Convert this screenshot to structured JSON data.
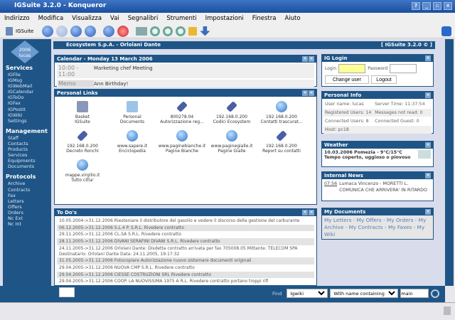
{
  "window": {
    "title": "IGSuite 3.2.0 - Konqueror",
    "controls": [
      "?",
      "_",
      "▫",
      "×"
    ]
  },
  "menu": [
    "Indirizzo",
    "Modifica",
    "Visualizza",
    "Vai",
    "Segnalibri",
    "Strumenti",
    "Impostazioni",
    "Finestra",
    "Aiuto"
  ],
  "toolbar": {
    "app_label": "IGSuite"
  },
  "header": {
    "company": "Ecosystem S.p.A. - Orlolani Dante",
    "version": "[ IGSuite 3.2.0 © ]"
  },
  "nav": {
    "year": "2006",
    "user": "lucas"
  },
  "sidebar": [
    {
      "title": "Services",
      "items": [
        "IGFile",
        "IGMsg",
        "IGWebMail",
        "IGCalendar",
        "IGToDo",
        "IGFax",
        "IGPostIt",
        "IGWiki",
        "Settings"
      ]
    },
    {
      "title": "Management",
      "items": [
        "Staff",
        "Contacts",
        "Products",
        "Services",
        "Equipments",
        "Documents"
      ]
    },
    {
      "title": "Protocols",
      "items": [
        "Archive",
        "Contracts",
        "Fax",
        "Letters",
        "Offers",
        "Orders",
        "Nc Ext",
        "Nc Int"
      ]
    }
  ],
  "calendar": {
    "title": "Calendar - Monday 13 March 2006",
    "rows": [
      {
        "k": "10:00 - 11:00",
        "v": "Marketing chef Meeting"
      },
      {
        "k": "Memo",
        "v": "Ann Birthday!"
      }
    ]
  },
  "links": {
    "title": "Personal Links",
    "items": [
      {
        "icon": "basket",
        "l1": "Basket",
        "l2": "IGSuite"
      },
      {
        "icon": "folder",
        "l1": "Personal",
        "l2": "Documents"
      },
      {
        "icon": "clip",
        "l1": "800278.04",
        "l2": "Autorizzazione reg..."
      },
      {
        "icon": "clip",
        "l1": "192.168.0.200",
        "l2": "Codici Ecosystem"
      },
      {
        "icon": "globe",
        "l1": "192.168.0.200",
        "l2": "Contatti trascurat..."
      },
      {
        "icon": "clip",
        "l1": "192.168.0.200",
        "l2": "Decreto Ronchi"
      },
      {
        "icon": "globe",
        "l1": "www.sapere.it",
        "l2": "Enciclopedia"
      },
      {
        "icon": "globe",
        "l1": "www.paginebianche.it",
        "l2": "Pagine Bianche"
      },
      {
        "icon": "globe",
        "l1": "www.paginegialle.it",
        "l2": "Pagine Gialle"
      },
      {
        "icon": "clip",
        "l1": "192.168.0.200",
        "l2": "Report su contatti"
      },
      {
        "icon": "globe",
        "l1": "mappe.virgilio.it",
        "l2": "Tutto citta'"
      }
    ]
  },
  "todo": {
    "title": "To Do's",
    "items": [
      "10.05.2004->31.12.2006 Riesteniare il distributore del gasolio e vedere il discorso della gestione del carburante",
      "06.12.2005->31.12.2006 S.L.4 P. S.R.L. Rivedere contratto",
      "29.11.2005->31.12.2006 CL.SA S.R.L. Rivedere contratto",
      "28.11.2005->31.12.2006 DIVANI SERAFINI DIVANI S.R.L. Rivedere contratto",
      "24.11.2005->31.12.2006 Orlolani Dante: Disdetta contratto arrivata per fax 705008.05 Mittente: TELECOM SPA Destinatario: Orlolani Dante Data: 24.11.2005, 19:17:32",
      "31.05.2005->31.12.2006 Fotocopiare Autorizzazione nuovo sistemare documenti originali",
      "29.04.2005->31.12.2006 NUOVA CMP S.R.L. Rivedere contratto",
      "29.04.2005->31.12.2006 CIESSE COSTRUZIONI SRL Rivedere contratto",
      "29.04.2005->31.12.2006 COOP. LA NUOVISSIMA 1975 A R.L. Rivedere contratto portano troppi rifi",
      "21.02.2005->31.12.2006 Effettuare urbanistica per la Tecna",
      "09.02.2005->31.12.2006 Cappellati efficienza operai cliente Cosmari da andare a vedere"
    ]
  },
  "login": {
    "title": "IG Login",
    "login_label": "Login",
    "password_label": "Password",
    "login_value": "",
    "change_user": "Change user",
    "logout": "Logout"
  },
  "info": {
    "title": "Personal Info",
    "rows": [
      [
        "User name: lucas",
        "Server Time: 11:37:54"
      ],
      [
        "Registered Users: 14",
        "Messages not read: 0"
      ],
      [
        "Connected Users: 8",
        "Connected Guest: 0"
      ],
      [
        "Host: pc18",
        ""
      ]
    ]
  },
  "weather": {
    "title": "Weather",
    "text": "10.03.2006 Pomezia - 9°C/15°C Tempo coperto, uggioso o piovoso"
  },
  "news": {
    "title": "Internal News",
    "time": "07:56",
    "text": "Lumaca Vincenzo - MORETTI L. COMUNICA CHE ARRIVERA' IN RITARDO"
  },
  "docs": {
    "title": "My Documents",
    "text": "My Letters - My Offers - My Orders - My Archive - My Contracts - My Faxes - My Wiki"
  },
  "find": {
    "label": "Find",
    "module": "Igwiki",
    "mode": "With name containing",
    "query": "main"
  }
}
